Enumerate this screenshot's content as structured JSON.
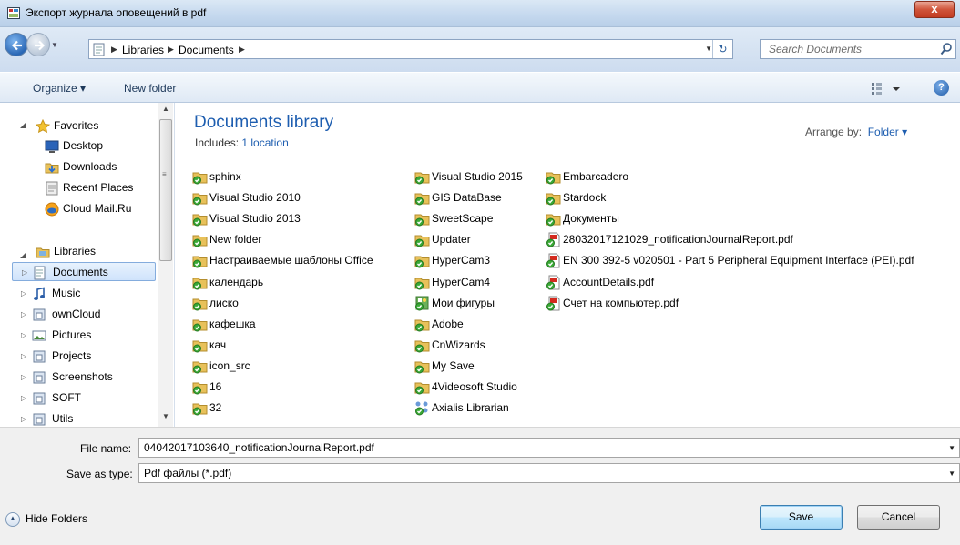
{
  "window": {
    "title": "Экспорт журнала оповещений в pdf",
    "close_label": "x"
  },
  "address": {
    "breadcrumbs": [
      "Libraries",
      "Documents"
    ],
    "search_placeholder": "Search Documents"
  },
  "toolbar": {
    "organize_label": "Organize ▾",
    "new_folder_label": "New folder",
    "help_label": "?"
  },
  "navigation": {
    "favorites_label": "Favorites",
    "favorites": [
      {
        "label": "Desktop",
        "icon": "desktop-icon"
      },
      {
        "label": "Downloads",
        "icon": "downloads-folder-icon"
      },
      {
        "label": "Recent Places",
        "icon": "recent-places-icon"
      },
      {
        "label": "Cloud Mail.Ru",
        "icon": "cloud-icon"
      }
    ],
    "libraries_label": "Libraries",
    "libraries": [
      {
        "label": "Documents",
        "icon": "documents-library-icon",
        "selected": true
      },
      {
        "label": "Music",
        "icon": "music-library-icon"
      },
      {
        "label": "ownCloud",
        "icon": "library-icon"
      },
      {
        "label": "Pictures",
        "icon": "pictures-library-icon"
      },
      {
        "label": "Projects",
        "icon": "library-icon"
      },
      {
        "label": "Screenshots",
        "icon": "library-icon"
      },
      {
        "label": "SOFT",
        "icon": "library-icon"
      },
      {
        "label": "Utils",
        "icon": "library-icon"
      }
    ]
  },
  "library": {
    "title": "Documents library",
    "includes_label": "Includes:",
    "includes_link": "1 location",
    "arrange_label": "Arrange by:",
    "arrange_value": "Folder ▾"
  },
  "files": {
    "column1": [
      "sphinx",
      "Visual Studio 2010",
      "Visual Studio 2013",
      "New folder",
      "Настраиваемые шаблоны Office",
      "календарь",
      "лиско",
      "кафешка",
      "кач",
      "icon_src",
      "16",
      "32"
    ],
    "column2": [
      "Visual Studio 2015",
      "GIS DataBase",
      "SweetScape",
      "Updater",
      "HyperCam3",
      "HyperCam4",
      "Мои фигуры",
      "Adobe",
      "CnWizards",
      "My Save",
      "4Videosoft Studio",
      "Axialis Librarian"
    ],
    "column3": [
      "Embarcadero",
      "Stardock",
      "Документы",
      "28032017121029_notificationJournalReport.pdf",
      "EN 300 392-5 v020501 - Part 5 Peripheral Equipment Interface (PEI).pdf",
      "AccountDetails.pdf",
      "Счет на компьютер.pdf"
    ]
  },
  "form": {
    "file_name_label": "File name:",
    "file_name_value": "04042017103640_notificationJournalReport.pdf",
    "save_type_label": "Save as type:",
    "save_type_value": "Pdf файлы (*.pdf)",
    "hide_folders_label": "Hide Folders",
    "save_label": "Save",
    "cancel_label": "Cancel"
  },
  "colors": {
    "link": "#1e5eb0",
    "folder": "#e8c15a",
    "sync_check": "#3aa935",
    "pdf_red": "#d42a1e"
  }
}
